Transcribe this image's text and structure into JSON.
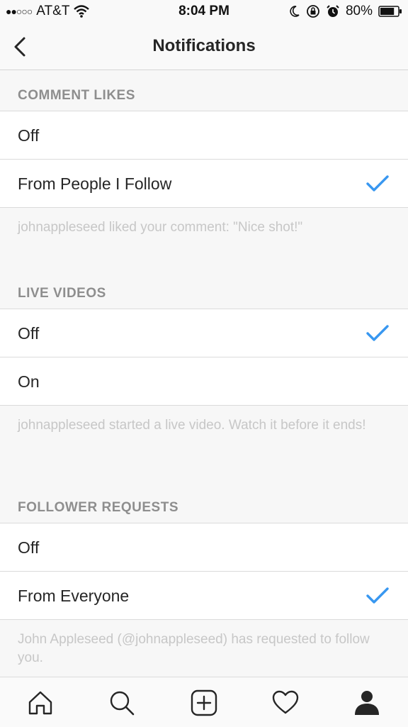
{
  "status_bar": {
    "signal_dots": "●●○○○",
    "carrier": "AT&T",
    "time": "8:04 PM",
    "battery_percent": "80%",
    "battery_level": 0.8
  },
  "nav": {
    "title": "Notifications"
  },
  "sections": [
    {
      "header": "COMMENT LIKES",
      "options": [
        {
          "label": "Off",
          "selected": false
        },
        {
          "label": "From People I Follow",
          "selected": true
        }
      ],
      "footnote": "johnappleseed liked your comment: \"Nice shot!\""
    },
    {
      "header": "LIVE VIDEOS",
      "options": [
        {
          "label": "Off",
          "selected": true
        },
        {
          "label": "On",
          "selected": false
        }
      ],
      "footnote": "johnappleseed started a live video. Watch it before it ends!"
    },
    {
      "header": "FOLLOWER REQUESTS",
      "options": [
        {
          "label": "Off",
          "selected": false
        },
        {
          "label": "From Everyone",
          "selected": true
        }
      ],
      "footnote": "John Appleseed (@johnappleseed) has requested to follow you."
    }
  ],
  "tab_bar": {
    "tabs": [
      "home-icon",
      "search-icon",
      "add-post-icon",
      "activity-heart-icon",
      "profile-icon"
    ],
    "active": "profile-icon"
  },
  "colors": {
    "accent_check": "#3897f0",
    "section_header": "#8e8e8e",
    "footnote": "#c7c7c7"
  }
}
